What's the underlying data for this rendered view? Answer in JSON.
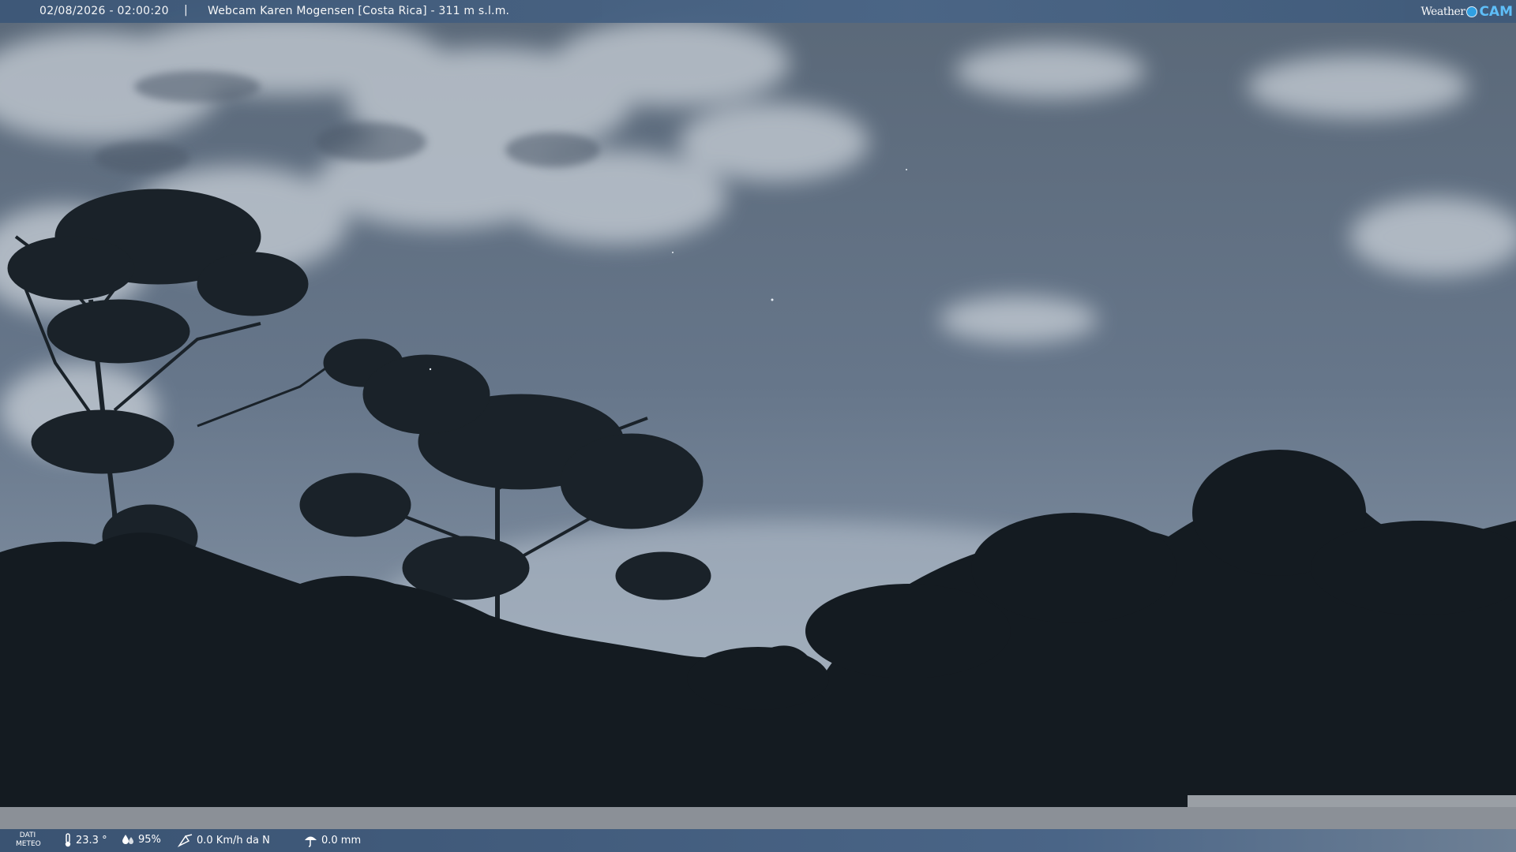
{
  "header": {
    "timestamp": "02/08/2026 - 02:00:20",
    "separator": "|",
    "title": "Webcam Karen Mogensen [Costa Rica]  - 311 m s.l.m.",
    "logo": {
      "word": "Weather",
      "cam": "CAM",
      "icon": "weather-dot-icon"
    }
  },
  "footer": {
    "label_line1": "DATI",
    "label_line2": "METEO",
    "temperature": "23.3 °",
    "humidity": "95%",
    "wind": "0.0 Km/h da N",
    "rain": "0.0 mm",
    "icons": [
      "thermometer-icon",
      "humidity-icon",
      "wind-icon",
      "rain-icon"
    ]
  },
  "colors": {
    "bar": "#4a6586",
    "sky": "#5f6e82",
    "foliage": "#151c22",
    "accent": "#2ea3e8"
  }
}
